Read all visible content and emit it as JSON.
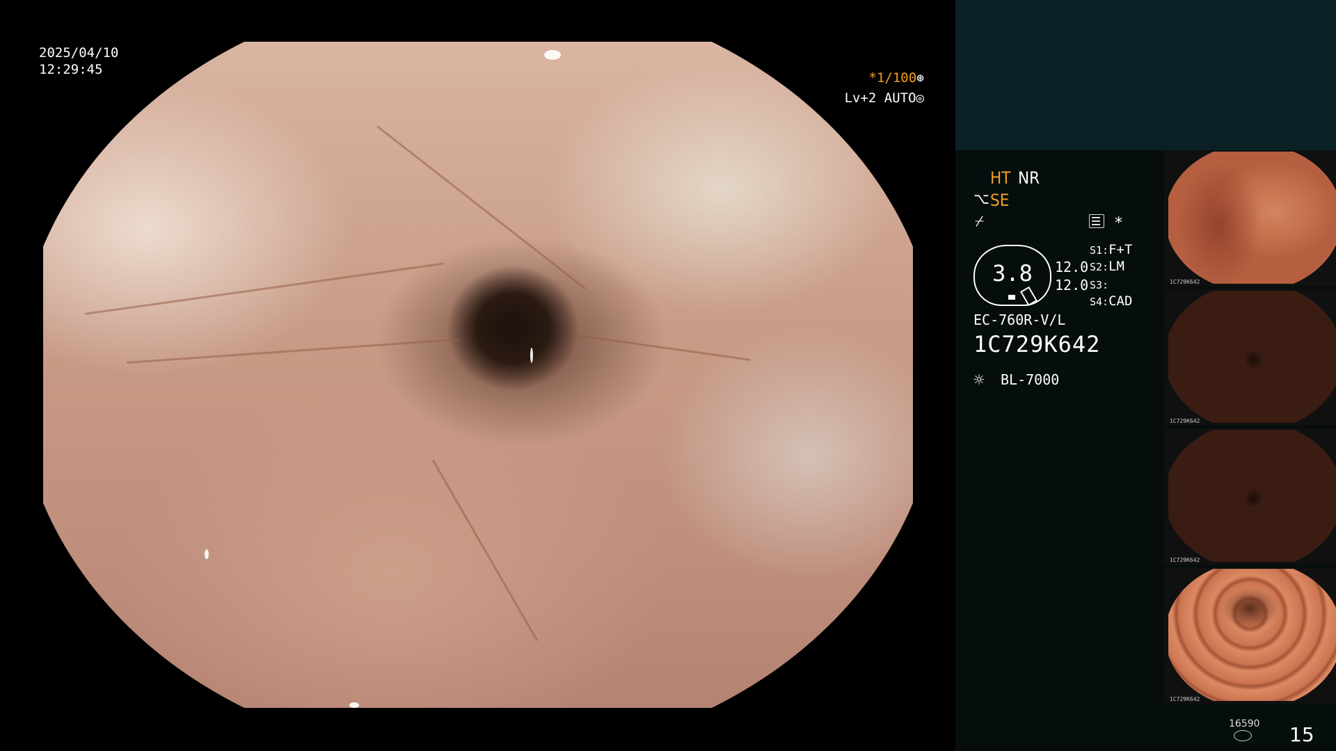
{
  "overlay": {
    "date": "2025/04/10",
    "time": "12:29:45",
    "shutter": "*1/100",
    "level": "Lv+2 AUTO"
  },
  "panel": {
    "modes": {
      "ht": "HT",
      "nr": "NR",
      "se": "SE"
    },
    "zoom": "3.8",
    "values": [
      "12.0",
      "12.0"
    ],
    "switches": [
      {
        "key": "S1:",
        "value": "F+T"
      },
      {
        "key": "S2:",
        "value": "LM"
      },
      {
        "key": "S3:",
        "value": ""
      },
      {
        "key": "S4:",
        "value": "CAD"
      }
    ],
    "scope_model": "EC-760R-V/L",
    "serial": "1C729K642",
    "light_source": "BL-7000",
    "storage_count": "16590",
    "image_count": "15"
  },
  "thumbnails": [
    {
      "label": "1C729K642"
    },
    {
      "label": "1C729K642"
    },
    {
      "label": "1C729K642"
    },
    {
      "label": "1C729K642"
    }
  ],
  "icons": {
    "shutter": "aperture-icon",
    "level": "iris-icon",
    "se": "scope-icon",
    "freeze": "freeze-icon",
    "menu": "menu-icon",
    "star": "star-icon",
    "light": "light-icon",
    "storage": "storage-icon"
  },
  "colors": {
    "accent": "#f0a020",
    "panel_top": "#0b2024",
    "panel_bg": "#060d0d"
  }
}
